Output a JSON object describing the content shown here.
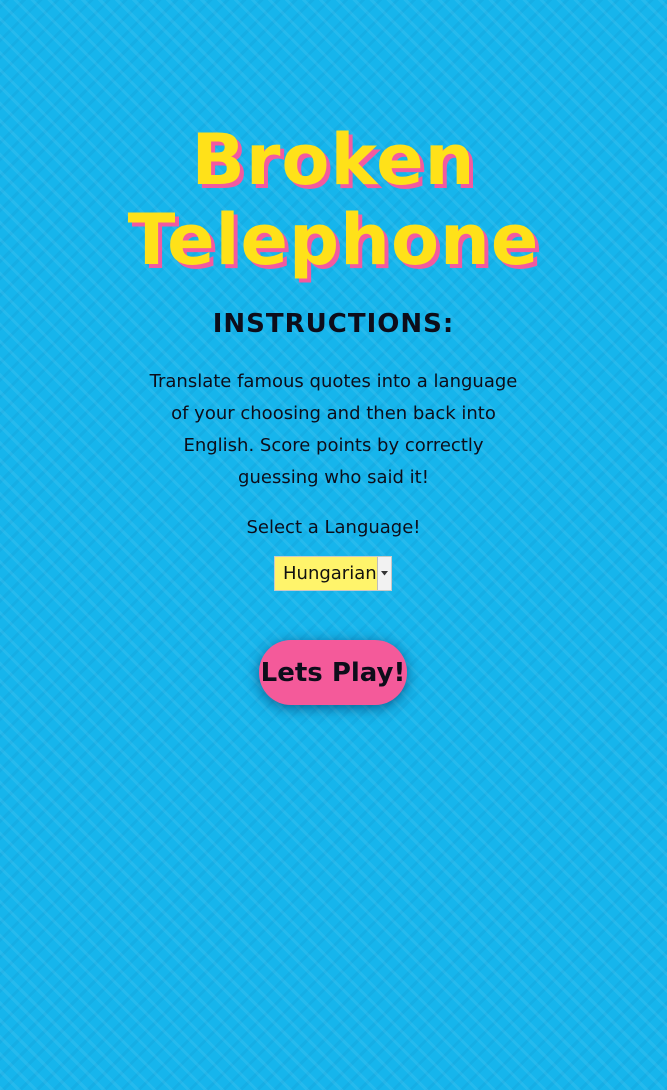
{
  "app": {
    "title_line1": "Broken",
    "title_line2": "Telephone"
  },
  "instructions": {
    "heading": "INSTRUCTIONS:",
    "text": "Translate famous quotes into a language of your choosing and then back into English. Score points by correctly guessing who said it!"
  },
  "language_select": {
    "label": "Select a Language!",
    "selected": "Hungarian",
    "arrow_icon": "chevron-down-icon"
  },
  "play_button": {
    "label": "Lets Play!"
  },
  "colors": {
    "background": "#16b5ec",
    "title": "#ffe119",
    "title_shadow": "#f25aa0",
    "select_background": "#fff46b",
    "button": "#f45a9a",
    "text": "#0d0d1a"
  }
}
